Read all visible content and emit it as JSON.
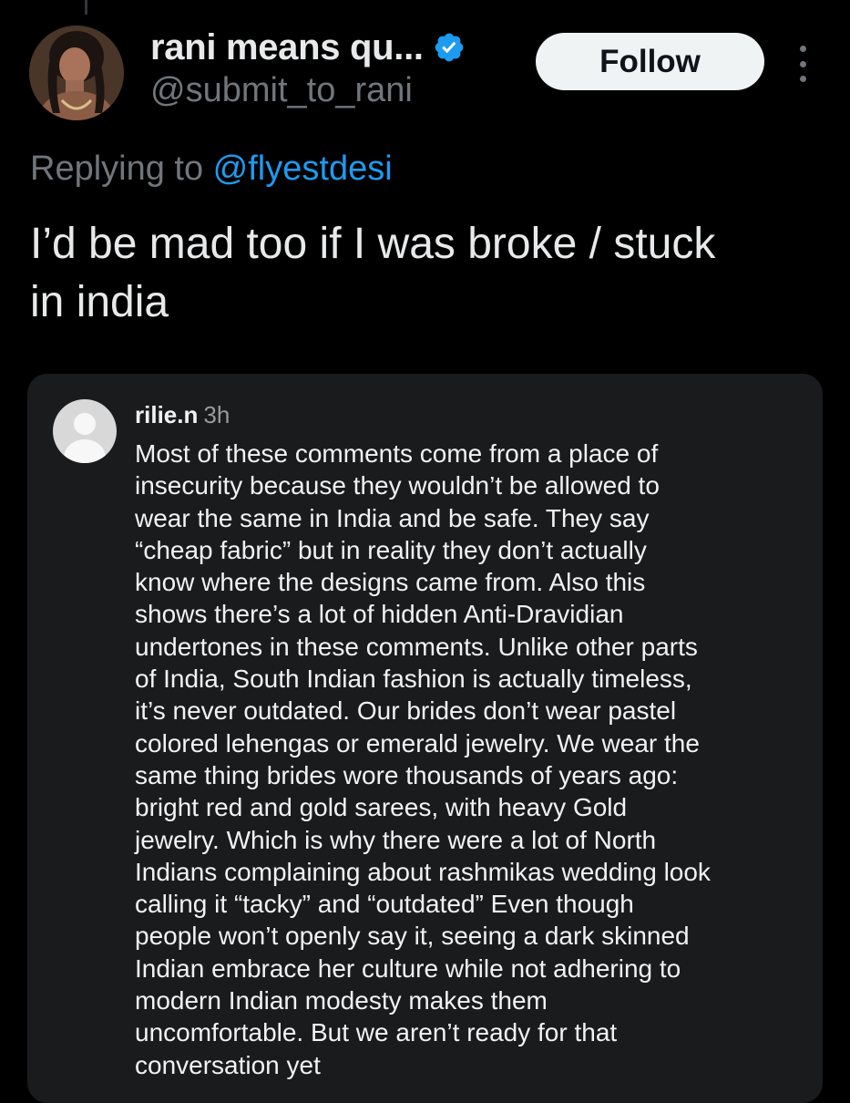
{
  "tweet": {
    "author": {
      "display_name": "rani means qu...",
      "handle": "@submit_to_rani",
      "verified_icon": "verified-badge-icon"
    },
    "follow_label": "Follow",
    "more_icon": "more-options-icon",
    "replying_prefix": "Replying to ",
    "replying_mention": "@flyestdesi",
    "text_lines": [
      "I’d be mad too if I was broke / stuck",
      "in india"
    ]
  },
  "embedded_comment": {
    "username": "rilie.n",
    "time": "3h",
    "lines": [
      "Most of these comments come from a place of",
      "insecurity because they wouldn’t be allowed to",
      "wear the same in India and be safe. They say",
      "“cheap fabric” but in reality they don’t actually",
      "know where the designs came from. Also this",
      "shows there’s a lot of hidden Anti-Dravidian",
      "undertones in these comments. Unlike other parts",
      "of India, South Indian fashion is actually timeless,",
      "it’s never outdated. Our brides don’t wear pastel",
      "colored lehengas or emerald jewelry. We wear the",
      "same thing brides wore thousands of years ago:",
      "bright red and gold sarees, with heavy Gold",
      "jewelry. Which is why there were a lot of North",
      "Indians complaining about rashmikas wedding look",
      "calling it “tacky” and “outdated” Even though",
      "people won’t openly say it, seeing a dark skinned",
      "Indian embrace her culture while not adhering to",
      "modern Indian modesty makes them",
      "uncomfortable. But we aren’t ready for that",
      "conversation yet"
    ]
  },
  "colors": {
    "background": "#000000",
    "primary_text": "#e7e9ea",
    "secondary_text": "#71767b",
    "link": "#1d9bf0",
    "verified": "#1d9bf0",
    "card_background": "#1a1b1d",
    "follow_button_bg": "#eff3f4"
  }
}
